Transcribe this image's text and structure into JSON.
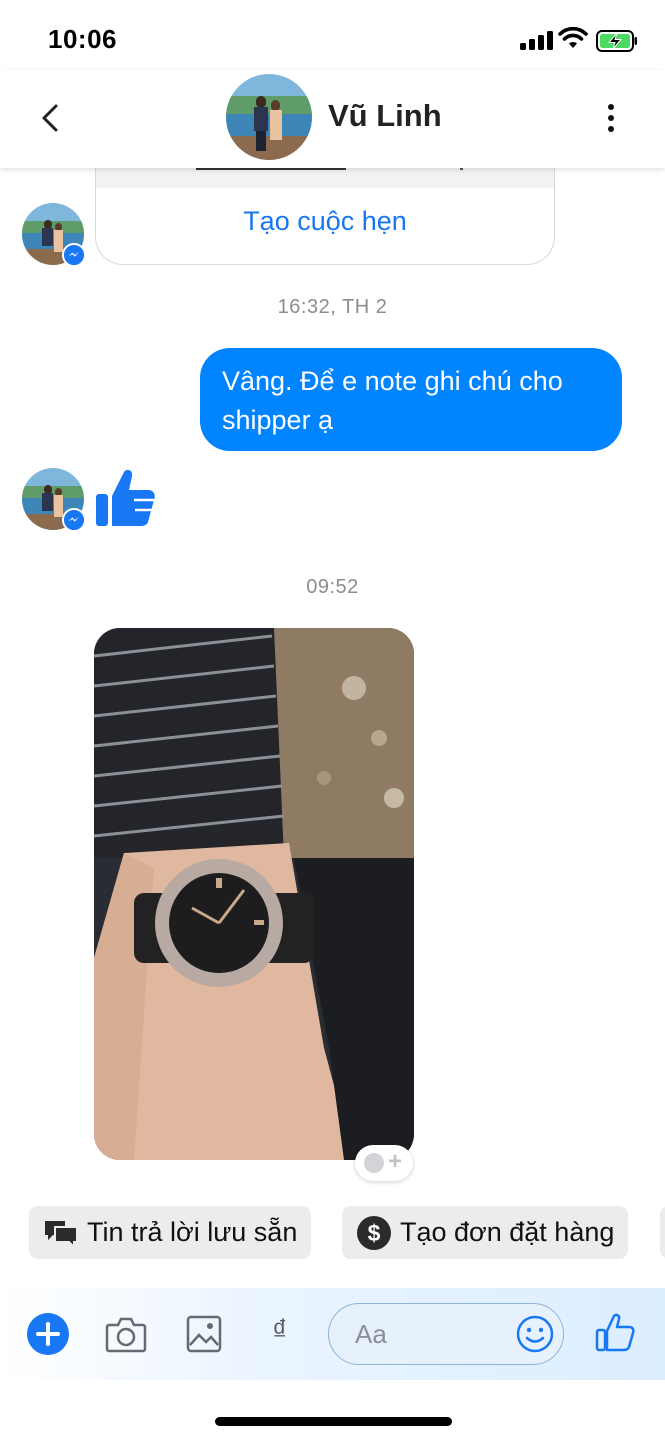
{
  "status_bar": {
    "time": "10:06"
  },
  "header": {
    "contact_name": "Vũ Linh"
  },
  "card": {
    "action_label": "Tạo cuộc hẹn"
  },
  "timestamps": [
    "16:32, TH 2",
    "09:52"
  ],
  "messages": {
    "outgoing_text": "Vâng. Để e note ghi chú cho shipper ạ"
  },
  "quick_replies": [
    "Tin trả lời lưu sẵn",
    "Tạo đơn đặt hàng"
  ],
  "composer": {
    "placeholder": "Aa",
    "currency_symbol": "₫"
  },
  "icons": [
    "back-icon",
    "more-icon",
    "thumbs-up-icon",
    "plus-icon",
    "camera-icon",
    "image-icon",
    "smiley-icon",
    "messenger-icon",
    "dollar-icon",
    "chat-bubbles-icon"
  ],
  "colors": {
    "accent": "#1877f2",
    "outgoing_bubble": "#0084ff"
  }
}
